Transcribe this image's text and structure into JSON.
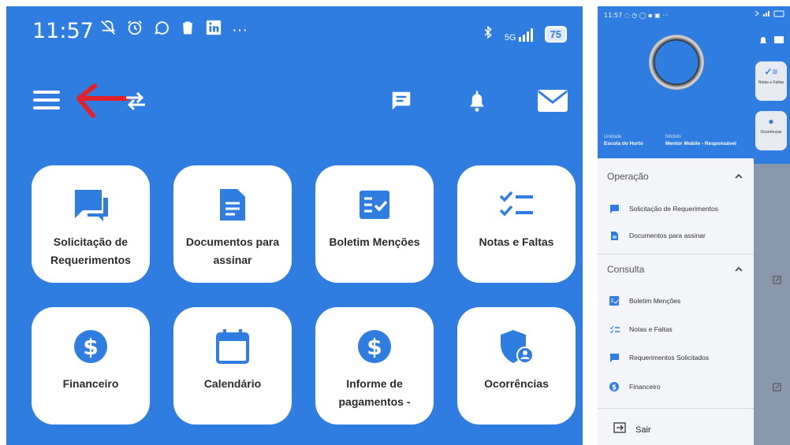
{
  "left": {
    "status": {
      "time": "11:57",
      "network": "5G",
      "battery": "75",
      "more": "···"
    },
    "cards": [
      {
        "label": "Solicitação de Requerimentos",
        "icon": "chat-icon"
      },
      {
        "label": "Documentos para assinar",
        "icon": "document-icon"
      },
      {
        "label": "Boletim Menções",
        "icon": "bulletin-check-icon"
      },
      {
        "label": "Notas e Faltas",
        "icon": "checklist-icon"
      },
      {
        "label": "Financeiro",
        "icon": "dollar-circle-icon"
      },
      {
        "label": "Calendário",
        "icon": "calendar-icon"
      },
      {
        "label": "Informe de pagamentos -",
        "icon": "dollar-circle-icon"
      },
      {
        "label": "Ocorrências",
        "icon": "shield-user-icon"
      }
    ]
  },
  "drawer": {
    "status": {
      "time": "11:57",
      "more": "···"
    },
    "unit_label": "Unidade",
    "unit_value": "Escola do Horto",
    "module_label": "Módulo",
    "module_value": "Mentor Mobile - Responsável",
    "sections": [
      {
        "title": "Operação",
        "items": [
          "Solicitação de Requerimentos",
          "Documentos para assinar"
        ]
      },
      {
        "title": "Consulta",
        "items": [
          "Boletim Menções",
          "Notas e Faltas",
          "Requerimentos Solicitados",
          "Financeiro"
        ]
      }
    ],
    "logout_label": "Sair"
  },
  "background_app": {
    "cards": [
      "Notas e Faltas",
      "Ocorrências"
    ]
  },
  "colors": {
    "primary": "#2f7de1",
    "card": "#ffffff",
    "annotation_arrow": "#e3212a"
  }
}
